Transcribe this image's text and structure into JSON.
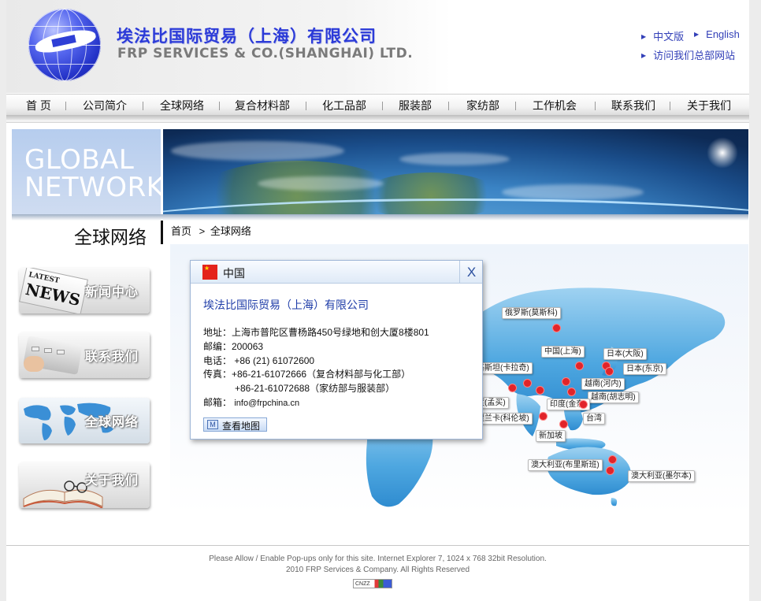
{
  "header": {
    "company_cn": "埃法比国际贸易（上海）有限公司",
    "company_en": "FRP SERVICES & CO.(SHANGHAI) LTD.",
    "lang_cn": "中文版",
    "lang_en": "English",
    "hq_link": "访问我们总部网站"
  },
  "nav": {
    "items": [
      "首 页",
      "公司简介",
      "全球网络",
      "复合材料部",
      "化工品部",
      "服装部",
      "家纺部",
      "工作机会",
      "联系我们",
      "关于我们"
    ]
  },
  "banner": {
    "title_line1": "GLOBAL",
    "title_line2": "NETWORK"
  },
  "section": {
    "title": "全球网络",
    "breadcrumb_home": "首页",
    "breadcrumb_sep": ">",
    "breadcrumb_current": "全球网络"
  },
  "sidebar": {
    "items": [
      {
        "label": "新闻中心",
        "icon": "latest-news-icon"
      },
      {
        "label": "联系我们",
        "icon": "phone-keypad-icon"
      },
      {
        "label": "全球网络",
        "icon": "world-map-icon"
      },
      {
        "label": "关于我们",
        "icon": "open-book-icon"
      }
    ]
  },
  "popup": {
    "country": "中国",
    "close": "X",
    "company": "埃法比国际贸易（上海）有限公司",
    "address": "地址：上海市普陀区曹杨路450号绿地和创大厦8楼801",
    "postcode": "邮编：200063",
    "phone": "电话： +86 (21) 61072600",
    "fax1": "传真：+86-21-61072666（复合材料部与化工部）",
    "fax2": "+86-21-61072688（家纺部与服装部）",
    "email_label": "邮箱：",
    "email": "info@frpchina.cn",
    "map_button": "查看地图",
    "map_button_icon": "M"
  },
  "map": {
    "cities": [
      {
        "id": "moscow",
        "label": "俄罗斯(莫斯科)"
      },
      {
        "id": "shanghai",
        "label": "中国(上海)"
      },
      {
        "id": "osaka",
        "label": "日本(大阪)"
      },
      {
        "id": "tokyo",
        "label": "日本(东京)"
      },
      {
        "id": "karachi",
        "label": "巴基斯坦(卡拉奇)"
      },
      {
        "id": "hanoi",
        "label": "越南(河内)"
      },
      {
        "id": "hcmc",
        "label": "越南(胡志明)"
      },
      {
        "id": "chennai",
        "label": "印度(金奈)"
      },
      {
        "id": "mumbai",
        "label": "印度(孟买)"
      },
      {
        "id": "colombo",
        "label": "斯里兰卡(科伦坡)"
      },
      {
        "id": "taiwan",
        "label": "台湾"
      },
      {
        "id": "singapore",
        "label": "新加坡"
      },
      {
        "id": "brisbane",
        "label": "澳大利亚(布里斯班)"
      },
      {
        "id": "melbourne",
        "label": "澳大利亚(墨尔本)"
      }
    ],
    "dot_color": "#e1242a"
  },
  "footer": {
    "line1": "Please Allow / Enable Pop-ups only for this site. Internet Explorer 7, 1024 x 768 32bit Resolution.",
    "line2": "2010 FRP Services & Company. All Rights Reserved",
    "badge": "CNZZ"
  },
  "colors": {
    "brand_blue": "#2b3ad8",
    "link_blue": "#3340b8",
    "map_blue": "#5fb3e6"
  }
}
